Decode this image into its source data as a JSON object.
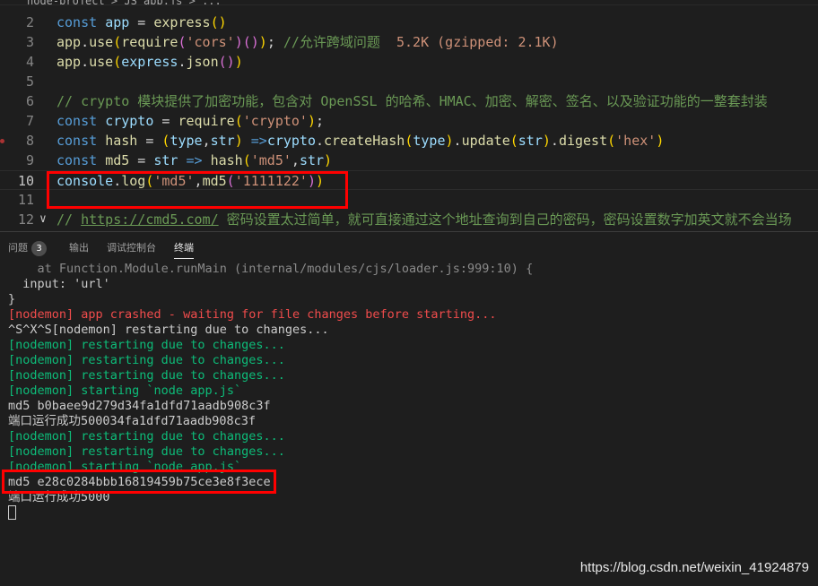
{
  "breadcrumb": "node-project > JS app.js > ...",
  "editor": {
    "lines": [
      {
        "n": "2",
        "tokens": [
          [
            "kw",
            "const "
          ],
          [
            "var",
            "app"
          ],
          [
            "pl",
            " = "
          ],
          [
            "fn",
            "express"
          ],
          [
            "p1",
            "()"
          ]
        ]
      },
      {
        "n": "3",
        "tokens": [
          [
            "fn",
            "app"
          ],
          [
            "pl",
            "."
          ],
          [
            "fn",
            "use"
          ],
          [
            "p1",
            "("
          ],
          [
            "fn",
            "require"
          ],
          [
            "p2",
            "("
          ],
          [
            "str",
            "'cors'"
          ],
          [
            "p2",
            ")"
          ],
          [
            "p2",
            "()"
          ],
          [
            "p1",
            ")"
          ],
          [
            "pl",
            "; "
          ],
          [
            "cm",
            "//允许跨域问题  "
          ],
          [
            "str",
            "5.2K (gzipped: 2.1K)"
          ]
        ]
      },
      {
        "n": "4",
        "tokens": [
          [
            "fn",
            "app"
          ],
          [
            "pl",
            "."
          ],
          [
            "fn",
            "use"
          ],
          [
            "p1",
            "("
          ],
          [
            "var",
            "express"
          ],
          [
            "pl",
            "."
          ],
          [
            "fn",
            "json"
          ],
          [
            "p2",
            "()"
          ],
          [
            "p1",
            ")"
          ]
        ]
      },
      {
        "n": "5",
        "tokens": []
      },
      {
        "n": "6",
        "tokens": [
          [
            "cm",
            "// crypto 模块提供了加密功能，包含对 OpenSSL 的哈希、HMAC、加密、解密、签名、以及验证功能的一整套封装"
          ]
        ]
      },
      {
        "n": "7",
        "tokens": [
          [
            "kw",
            "const "
          ],
          [
            "var",
            "crypto"
          ],
          [
            "pl",
            " = "
          ],
          [
            "fn",
            "require"
          ],
          [
            "p1",
            "("
          ],
          [
            "str",
            "'crypto'"
          ],
          [
            "p1",
            ")"
          ],
          [
            "pl",
            ";"
          ]
        ]
      },
      {
        "n": "8",
        "tokens": [
          [
            "kw",
            "const "
          ],
          [
            "fn",
            "hash"
          ],
          [
            "pl",
            " = "
          ],
          [
            "p1",
            "("
          ],
          [
            "var",
            "type"
          ],
          [
            "pl",
            ","
          ],
          [
            "var",
            "str"
          ],
          [
            "p1",
            ")"
          ],
          [
            "kw",
            " =>"
          ],
          [
            "var",
            "crypto"
          ],
          [
            "pl",
            "."
          ],
          [
            "fn",
            "createHash"
          ],
          [
            "p1",
            "("
          ],
          [
            "var",
            "type"
          ],
          [
            "p1",
            ")"
          ],
          [
            "pl",
            "."
          ],
          [
            "fn",
            "update"
          ],
          [
            "p1",
            "("
          ],
          [
            "var",
            "str"
          ],
          [
            "p1",
            ")"
          ],
          [
            "pl",
            "."
          ],
          [
            "fn",
            "digest"
          ],
          [
            "p1",
            "("
          ],
          [
            "str",
            "'hex'"
          ],
          [
            "p1",
            ")"
          ]
        ]
      },
      {
        "n": "9",
        "tokens": [
          [
            "kw",
            "const "
          ],
          [
            "fn",
            "md5"
          ],
          [
            "pl",
            " = "
          ],
          [
            "var",
            "str"
          ],
          [
            "kw",
            " => "
          ],
          [
            "fn",
            "hash"
          ],
          [
            "p1",
            "("
          ],
          [
            "str",
            "'md5'"
          ],
          [
            "pl",
            ","
          ],
          [
            "var",
            "str"
          ],
          [
            "p1",
            ")"
          ]
        ]
      },
      {
        "n": "10",
        "tokens": [
          [
            "var",
            "console"
          ],
          [
            "pl",
            "."
          ],
          [
            "fn",
            "log"
          ],
          [
            "p1",
            "("
          ],
          [
            "str",
            "'md5'"
          ],
          [
            "pl",
            ","
          ],
          [
            "fn",
            "md5"
          ],
          [
            "p2",
            "("
          ],
          [
            "str",
            "'1111122'"
          ],
          [
            "p2",
            ")"
          ],
          [
            "p1",
            ")"
          ]
        ]
      },
      {
        "n": "11",
        "tokens": []
      },
      {
        "n": "12",
        "tokens": [
          [
            "cm",
            "// "
          ],
          [
            "cmu",
            "https://cmd5.com/"
          ],
          [
            "cm",
            " 密码设置太过简单，就可直接通过这个地址查询到自己的密码，密码设置数字加英文就不会当场"
          ]
        ]
      }
    ]
  },
  "panel": {
    "tabs": [
      {
        "label": "问题",
        "badge": "3"
      },
      {
        "label": "输出"
      },
      {
        "label": "调试控制台"
      },
      {
        "label": "终端",
        "active": true
      }
    ]
  },
  "terminal": [
    [
      "t-dim",
      "    at Function.Module.runMain (internal/modules/cjs/loader.js:999:10) {"
    ],
    [
      "t-white",
      "  input: 'url'"
    ],
    [
      "t-white",
      "}"
    ],
    [
      "t-red",
      "[nodemon] app crashed - waiting for file changes before starting..."
    ],
    [
      "t-white",
      "^S^X^S[nodemon] restarting due to changes..."
    ],
    [
      "t-green",
      "[nodemon] restarting due to changes..."
    ],
    [
      "t-green",
      "[nodemon] restarting due to changes..."
    ],
    [
      "t-green",
      "[nodemon] restarting due to changes..."
    ],
    [
      "t-green",
      "[nodemon] starting `node app.js`"
    ],
    [
      "t-white",
      "md5 b0baee9d279d34fa1dfd71aadb908c3f"
    ],
    [
      "t-white",
      "端口运行成功500034fa1dfd71aadb908c3f"
    ],
    [
      "t-green",
      "[nodemon] restarting due to changes..."
    ],
    [
      "t-green",
      "[nodemon] restarting due to changes..."
    ],
    [
      "t-green",
      "[nodemon] starting `node app.js`"
    ],
    [
      "t-white",
      "md5 e28c0284bbb16819459b75ce3e8f3ece"
    ],
    [
      "t-white",
      "端口运行成功5000"
    ]
  ],
  "watermark": "https://blog.csdn.net/weixin_41924879"
}
